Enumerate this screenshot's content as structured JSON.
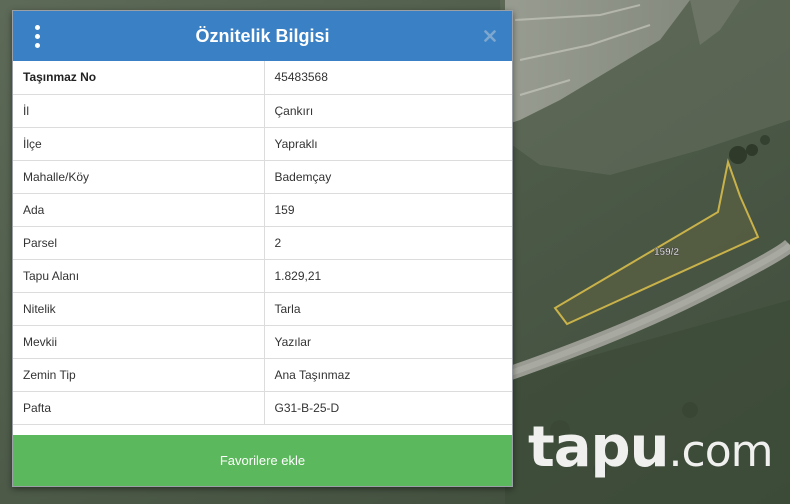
{
  "panel": {
    "title": "Öznitelik Bilgisi",
    "menu_icon": "vertical-ellipsis-icon",
    "close_icon": "close-icon",
    "header_color": "#3a80c4",
    "rows": [
      {
        "key": "Taşınmaz No",
        "value": "45483568"
      },
      {
        "key": "İl",
        "value": "Çankırı"
      },
      {
        "key": "İlçe",
        "value": "Yapraklı"
      },
      {
        "key": "Mahalle/Köy",
        "value": "Bademçay"
      },
      {
        "key": "Ada",
        "value": "159"
      },
      {
        "key": "Parsel",
        "value": "2"
      },
      {
        "key": "Tapu Alanı",
        "value": "1.829,21"
      },
      {
        "key": "Nitelik",
        "value": "Tarla"
      },
      {
        "key": "Mevkii",
        "value": "Yazılar"
      },
      {
        "key": "Zemin Tip",
        "value": "Ana Taşınmaz"
      },
      {
        "key": "Pafta",
        "value": "G31-B-25-D"
      }
    ],
    "favorite_button_label": "Favorilere ekle",
    "favorite_button_color": "#5cb85c"
  },
  "map": {
    "parcel_label": "159/2",
    "parcel_outline_color": "#c9b24a"
  },
  "watermark": {
    "main": "tapu",
    "tld": ".com"
  }
}
